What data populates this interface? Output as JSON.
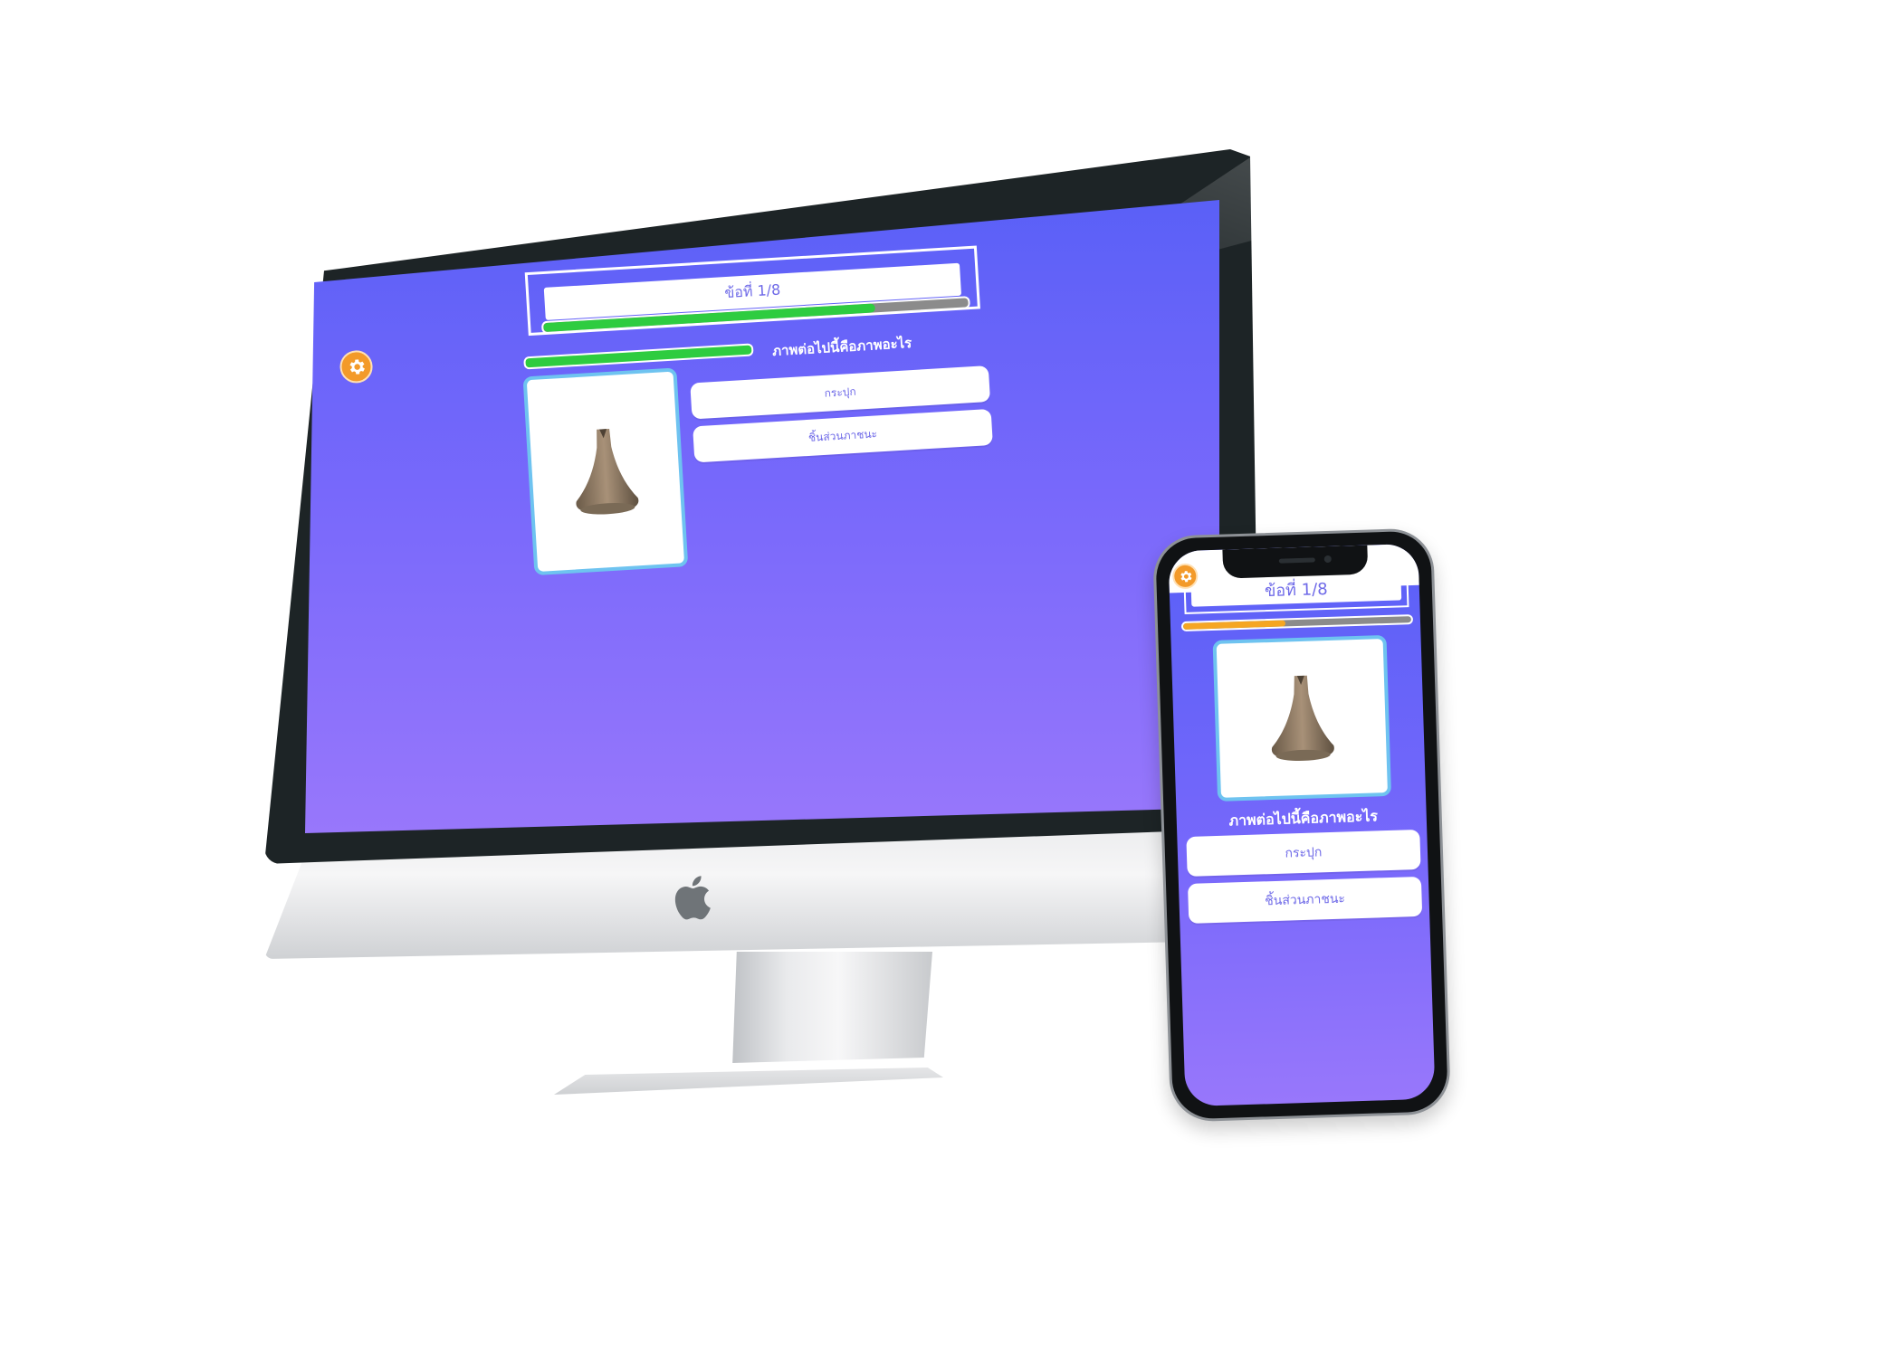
{
  "desktop": {
    "question_counter": "ข้อที่ 1/8",
    "progress": 0.78,
    "progress_color": "#2ecc40",
    "question_text": "ภาพต่อไปนี้คือภาพอะไร",
    "answers": [
      "กระปุก",
      "ชิ้นส่วนภาชนะ"
    ],
    "image_subject": "clay-bell-artifact",
    "settings_icon": "gear-icon"
  },
  "mobile": {
    "question_counter": "ข้อที่ 1/8",
    "progress": 0.45,
    "progress_color": "#f5a623",
    "question_text": "ภาพต่อไปนี้คือภาพอะไร",
    "answers": [
      "กระปุก",
      "ชิ้นส่วนภาชนะ"
    ],
    "image_subject": "clay-bell-artifact",
    "settings_icon": "gear-icon"
  },
  "colors": {
    "screen_top": "#5a60f7",
    "screen_bottom": "#9877fb",
    "accent_text": "#6f6ae8",
    "card_border": "#6ec3f0",
    "settings_button": "#f39a2a"
  }
}
